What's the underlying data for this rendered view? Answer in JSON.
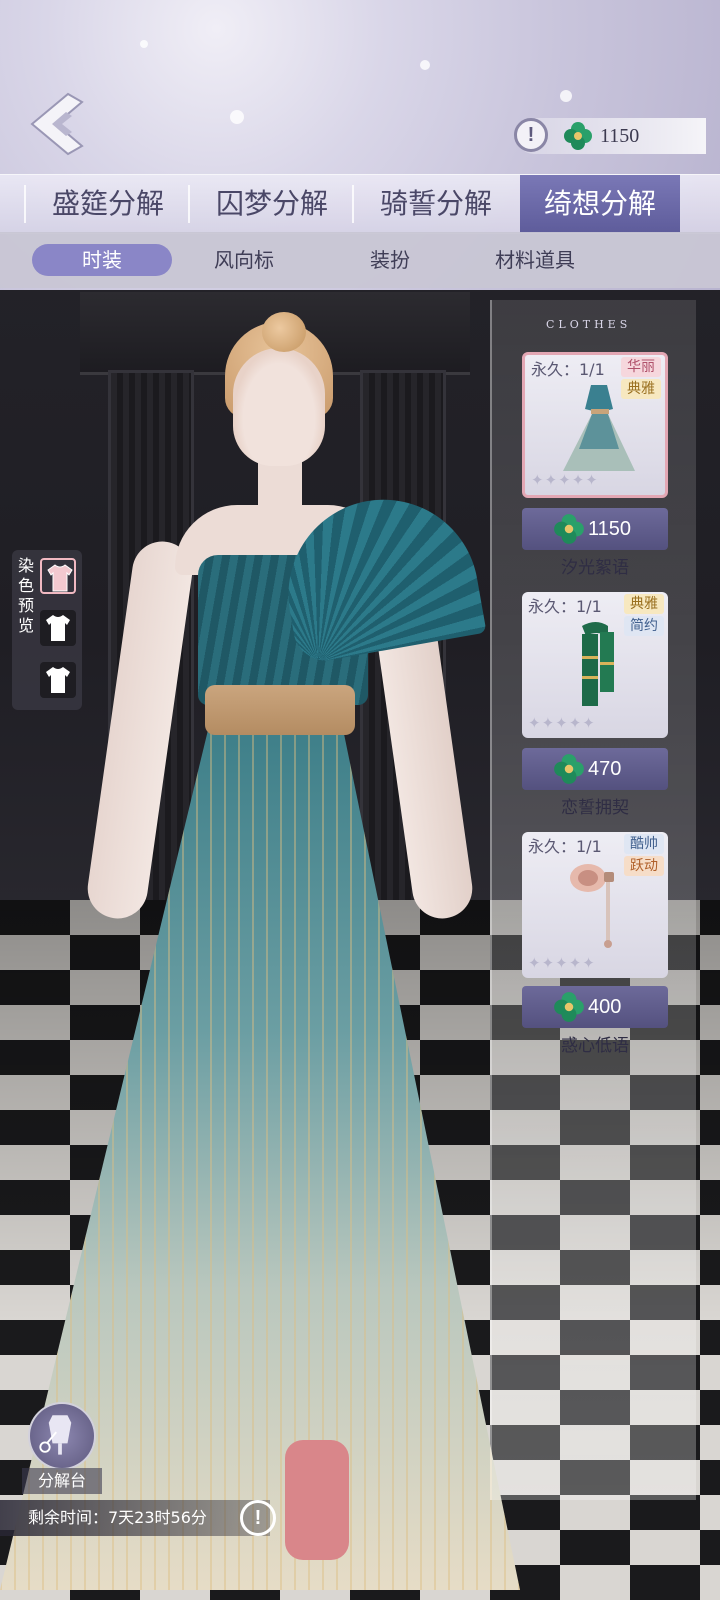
{
  "currency": {
    "amount": "1150",
    "icon": "green-clover-gem-icon",
    "info_symbol": "!"
  },
  "main_tabs": [
    {
      "label": "盛筵分解",
      "active": false
    },
    {
      "label": "囚梦分解",
      "active": false
    },
    {
      "label": "骑誓分解",
      "active": false
    },
    {
      "label": "绮想分解",
      "active": true
    }
  ],
  "sub_tabs": [
    {
      "label": "时装",
      "active": true
    },
    {
      "label": "风向标",
      "active": false
    },
    {
      "label": "装扮",
      "active": false
    },
    {
      "label": "材料道具",
      "active": false
    }
  ],
  "dye_preview": {
    "label": "染色预览",
    "swatch_colors": [
      "#f3c9cf",
      "#ffffff",
      "#ffffff"
    ]
  },
  "panel_header": "CLOTHES",
  "items": [
    {
      "permanence": "永久：1/1",
      "tags": [
        "华丽",
        "典雅"
      ],
      "price": "1150",
      "name": "汐光絮语",
      "selected": true
    },
    {
      "permanence": "永久：1/1",
      "tags": [
        "典雅",
        "简约"
      ],
      "price": "470",
      "name": "恋誓拥契",
      "selected": false
    },
    {
      "permanence": "永久：1/1",
      "tags": [
        "酷帅",
        "跃动"
      ],
      "price": "400",
      "name": "惑心低语",
      "selected": false
    }
  ],
  "stars_glyph": "✦✦✦✦✦",
  "decompose": {
    "label": "分解台"
  },
  "timer": {
    "text": "剩余时间：7天23时56分",
    "info_symbol": "!"
  },
  "colors": {
    "accent": "#6d6a9a",
    "active_tab": "#5e5c9b",
    "selected_border": "#e3a7b4"
  }
}
